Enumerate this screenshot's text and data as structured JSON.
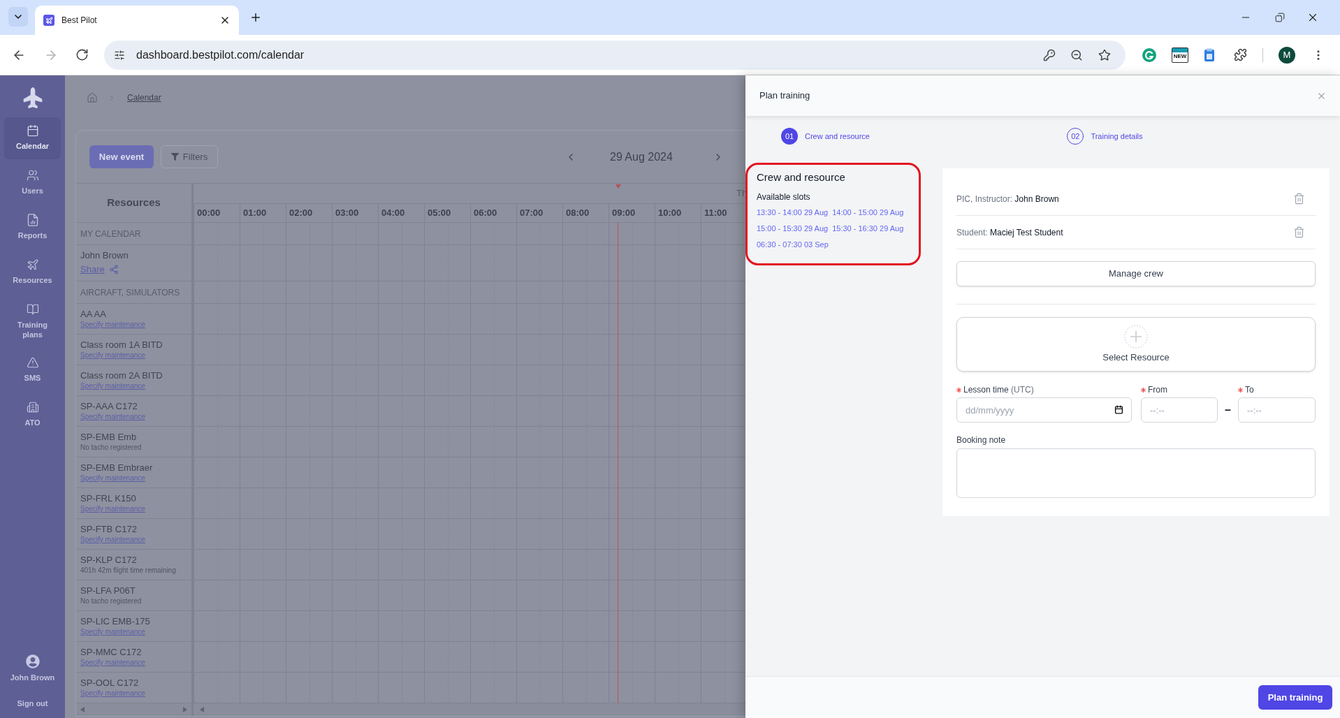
{
  "browser": {
    "tab_title": "Best Pilot",
    "url": "dashboard.bestpilot.com/calendar",
    "forward_disabled": true,
    "extension_label": "NEW",
    "profile_initial": "M"
  },
  "sidebar": {
    "items": [
      {
        "label": "Calendar",
        "selected": true
      },
      {
        "label": "Users",
        "selected": false
      },
      {
        "label": "Reports",
        "selected": false
      },
      {
        "label": "Resources",
        "selected": false
      },
      {
        "label": "Training plans",
        "selected": false
      },
      {
        "label": "SMS",
        "selected": false
      },
      {
        "label": "ATO",
        "selected": false
      }
    ],
    "user": "John Brown",
    "sign_out": "Sign out"
  },
  "breadcrumb": {
    "current": "Calendar"
  },
  "calendar": {
    "new_event": "New event",
    "filters": "Filters",
    "date": "29 Aug 2024",
    "day_label": "Th",
    "resources_heading": "Resources",
    "hours": [
      "00:00",
      "01:00",
      "02:00",
      "03:00",
      "04:00",
      "05:00",
      "06:00",
      "07:00",
      "08:00",
      "09:00",
      "10:00",
      "11:00"
    ],
    "groups": [
      {
        "label": "MY CALENDAR",
        "rows": [
          {
            "name": "John Brown",
            "kind": "share",
            "note": "Share"
          }
        ]
      },
      {
        "label": "AIRCRAFT, SIMULATORS",
        "rows": [
          {
            "name": "AA AA",
            "kind": "link",
            "note": "Specify maintenance"
          },
          {
            "name": "Class room 1A BITD",
            "kind": "link",
            "note": "Specify maintenance"
          },
          {
            "name": "Class room 2A BITD",
            "kind": "link",
            "note": "Specify maintenance"
          },
          {
            "name": "SP-AAA C172",
            "kind": "link",
            "note": "Specify maintenance"
          },
          {
            "name": "SP-EMB Emb",
            "kind": "text",
            "note": "No tacho registered"
          },
          {
            "name": "SP-EMB Embraer",
            "kind": "link",
            "note": "Specify maintenance"
          },
          {
            "name": "SP-FRL K150",
            "kind": "link",
            "note": "Specify maintenance"
          },
          {
            "name": "SP-FTB C172",
            "kind": "link",
            "note": "Specify maintenance"
          },
          {
            "name": "SP-KLP C172",
            "kind": "text",
            "note": "401h 42m flight time remaining"
          },
          {
            "name": "SP-LFA P06T",
            "kind": "text",
            "note": "No tacho registered"
          },
          {
            "name": "SP-LIC EMB-175",
            "kind": "link",
            "note": "Specify maintenance"
          },
          {
            "name": "SP-MMC C172",
            "kind": "link",
            "note": "Specify maintenance"
          },
          {
            "name": "SP-OOL C172",
            "kind": "link",
            "note": "Specify maintenance"
          }
        ]
      }
    ]
  },
  "panel": {
    "title": "Plan training",
    "steps": [
      {
        "number": "01",
        "label": "Crew and resource",
        "selected": true
      },
      {
        "number": "02",
        "label": "Training details",
        "selected": false
      }
    ],
    "summary": {
      "highlighted": true,
      "title": "Crew and resource",
      "subtitle": "Available slots",
      "slots": [
        "13:30 - 14:00 29 Aug",
        "14:00 - 15:00 29 Aug",
        "15:00 - 15:30 29 Aug",
        "15:30 - 16:30 29 Aug",
        "06:30 - 07:30 03 Sep"
      ]
    },
    "crew": [
      {
        "role": "PIC, Instructor:",
        "name": "John Brown"
      },
      {
        "role": "Student:",
        "name": "Maciej Test Student"
      }
    ],
    "manage_crew": "Manage crew",
    "select_resource": "Select Resource",
    "fields": [
      {
        "label": "Lesson time",
        "hint": "(UTC)",
        "required": true,
        "kind": "date",
        "placeholder": "dd/mm/yyyy"
      },
      {
        "label": "From",
        "required": true,
        "kind": "time",
        "placeholder": "--:--"
      },
      {
        "label": "To",
        "required": true,
        "kind": "time",
        "placeholder": "--:--"
      }
    ],
    "range_separator": "–",
    "note_field": {
      "label": "Booking note"
    },
    "submit": "Plan training"
  }
}
